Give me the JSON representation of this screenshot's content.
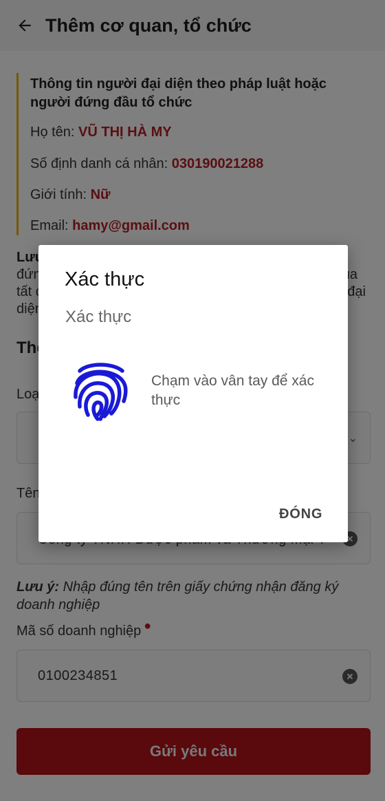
{
  "appbar": {
    "title": "Thêm cơ quan, tổ chức"
  },
  "info_card": {
    "title": "Thông tin người đại diện theo pháp luật hoặc người đứng đầu tổ chức",
    "name_label": "Họ tên:",
    "name_value": "VŨ THỊ HÀ MY",
    "id_label": "Số định danh cá nhân:",
    "id_value": "030190021288",
    "gender_label": "Giới tính:",
    "gender_value": "Nữ",
    "email_label": "Email:",
    "email_value": "hamy@gmail.com"
  },
  "note1": {
    "lead": "Lưu",
    "line1": "đứn",
    "line1_end": "ua",
    "line2": "tất c",
    "line2_end": "đại",
    "line3": "diện"
  },
  "section": {
    "title": "Thô"
  },
  "fields": {
    "org_type_label": "Loạ",
    "org_name_label": "Tên",
    "org_name_value": "Công ty TNHH Dược phẩm và Thương mại T",
    "tax_code_label": "Mã số doanh nghiệp",
    "tax_code_value": "0100234851"
  },
  "note2": {
    "lead": "Lưu ý:",
    "text": " Nhập đúng tên trên giấy chứng nhận đăng ký doanh nghiệp"
  },
  "submit": {
    "label": "Gửi yêu cầu"
  },
  "dialog": {
    "title": "Xác thực",
    "subtitle": "Xác thực",
    "description": "Chạm vào vân tay để xác thực",
    "close_label": "ĐÓNG",
    "icon": "fingerprint-icon",
    "icon_color": "#1a1ad6"
  },
  "colors": {
    "accent": "#b41e24",
    "button": "#b5121b",
    "card_border": "#e8b000"
  }
}
